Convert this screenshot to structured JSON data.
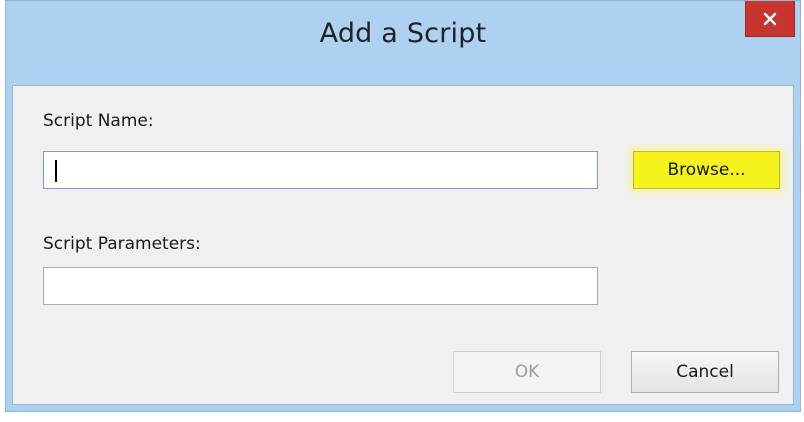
{
  "window": {
    "title": "Add a Script",
    "close_symbol": "×"
  },
  "form": {
    "script_name_label": "Script Name:",
    "script_name_value": "",
    "browse_label": "Browse...",
    "script_parameters_label": "Script Parameters:",
    "script_parameters_value": ""
  },
  "buttons": {
    "ok_label": "OK",
    "ok_enabled": false,
    "cancel_label": "Cancel"
  },
  "colors": {
    "titlebar": "#aed1f1",
    "close_button": "#c7352f",
    "browse_highlight": "#f6f21c",
    "client_background": "#f0f0f0"
  },
  "icons": {
    "close": "close-icon"
  }
}
